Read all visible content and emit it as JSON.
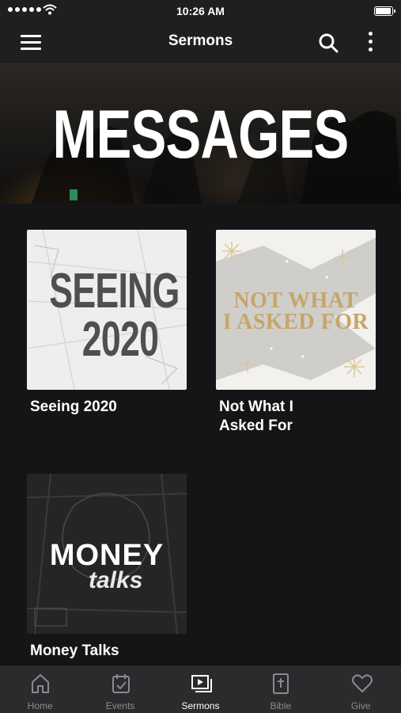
{
  "status_bar": {
    "time": "10:26 AM"
  },
  "nav": {
    "title": "Sermons"
  },
  "banner": {
    "title": "MESSAGES"
  },
  "sermons": [
    {
      "title": "Seeing 2020",
      "art_line1": "SEEING",
      "art_line2": "2020"
    },
    {
      "title": "Not What I Asked For",
      "art_line1": "NOT WHAT",
      "art_line2": "I ASKED FOR"
    },
    {
      "title": "Money Talks",
      "art_line1": "MONEY",
      "art_line2": "talks"
    }
  ],
  "tabs": [
    {
      "label": "Home",
      "icon": "home-icon",
      "active": false
    },
    {
      "label": "Events",
      "icon": "calendar-icon",
      "active": false
    },
    {
      "label": "Sermons",
      "icon": "video-icon",
      "active": true
    },
    {
      "label": "Bible",
      "icon": "bible-icon",
      "active": false
    },
    {
      "label": "Give",
      "icon": "heart-icon",
      "active": false
    }
  ],
  "colors": {
    "background": "#141517",
    "bar": "#1e1f21",
    "tabbar": "#2a2b2d",
    "tab_inactive": "#8a8b8e",
    "gold": "#c5a66a"
  }
}
